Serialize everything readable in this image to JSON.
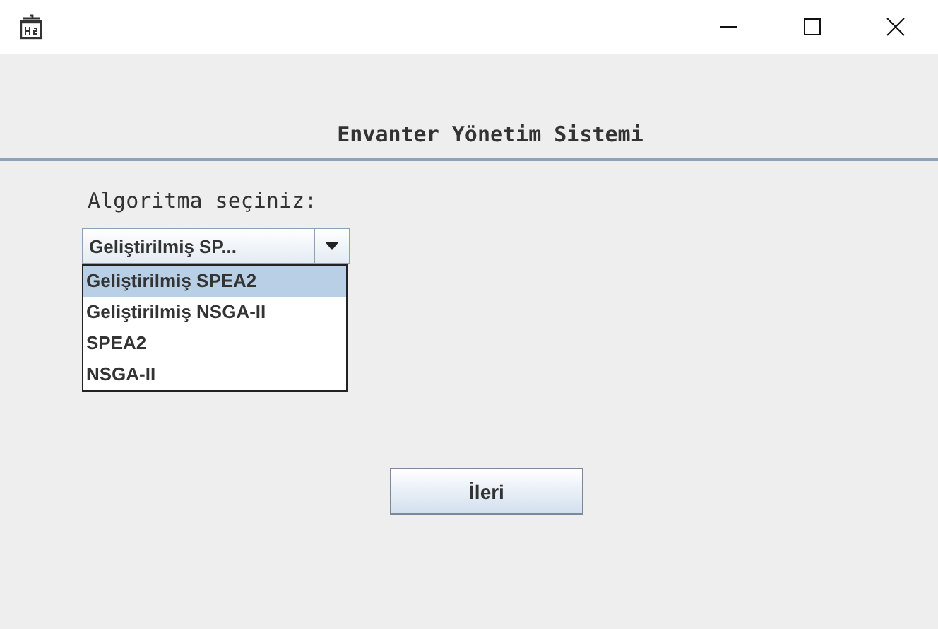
{
  "header": {
    "title": "Envanter Yönetim Sistemi"
  },
  "form": {
    "label": "Algoritma seçiniz:",
    "combo": {
      "value": "Geliştirilmiş SP...",
      "expanded": true,
      "options": [
        {
          "label": "Geliştirilmiş SPEA2",
          "selected": true
        },
        {
          "label": "Geliştirilmiş NSGA-II",
          "selected": false
        },
        {
          "label": "SPEA2",
          "selected": false
        },
        {
          "label": "NSGA-II",
          "selected": false
        }
      ]
    }
  },
  "next_button": {
    "label": "İleri"
  }
}
